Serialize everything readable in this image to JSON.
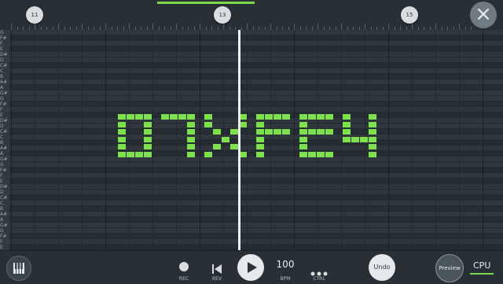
{
  "timeline": {
    "markers": [
      "11",
      "13",
      "15"
    ],
    "close_icon": "close-icon"
  },
  "piano_keys": [
    "G",
    "F#",
    "F",
    "E",
    "D#",
    "D",
    "C#",
    "C",
    "B",
    "A#",
    "A",
    "G#",
    "G",
    "F#",
    "F",
    "E",
    "D#",
    "D",
    "C#",
    "C",
    "B",
    "A#",
    "A",
    "G#",
    "G",
    "F#",
    "F",
    "E",
    "D#",
    "D",
    "C#",
    "C",
    "B",
    "A#",
    "A",
    "G#",
    "G",
    "F#",
    "F",
    "E"
  ],
  "colors": {
    "note": "#7fe04d",
    "accent": "#7fd651",
    "background": "#2b3238"
  },
  "toolbar": {
    "rec_label": "REC",
    "rev_label": "REV",
    "bpm_value": "100",
    "bpm_label": "BPM",
    "ctrl_label": "CTRL",
    "undo_label": "Undo",
    "preview_label": "Preview",
    "cpu_label": "CPU"
  }
}
